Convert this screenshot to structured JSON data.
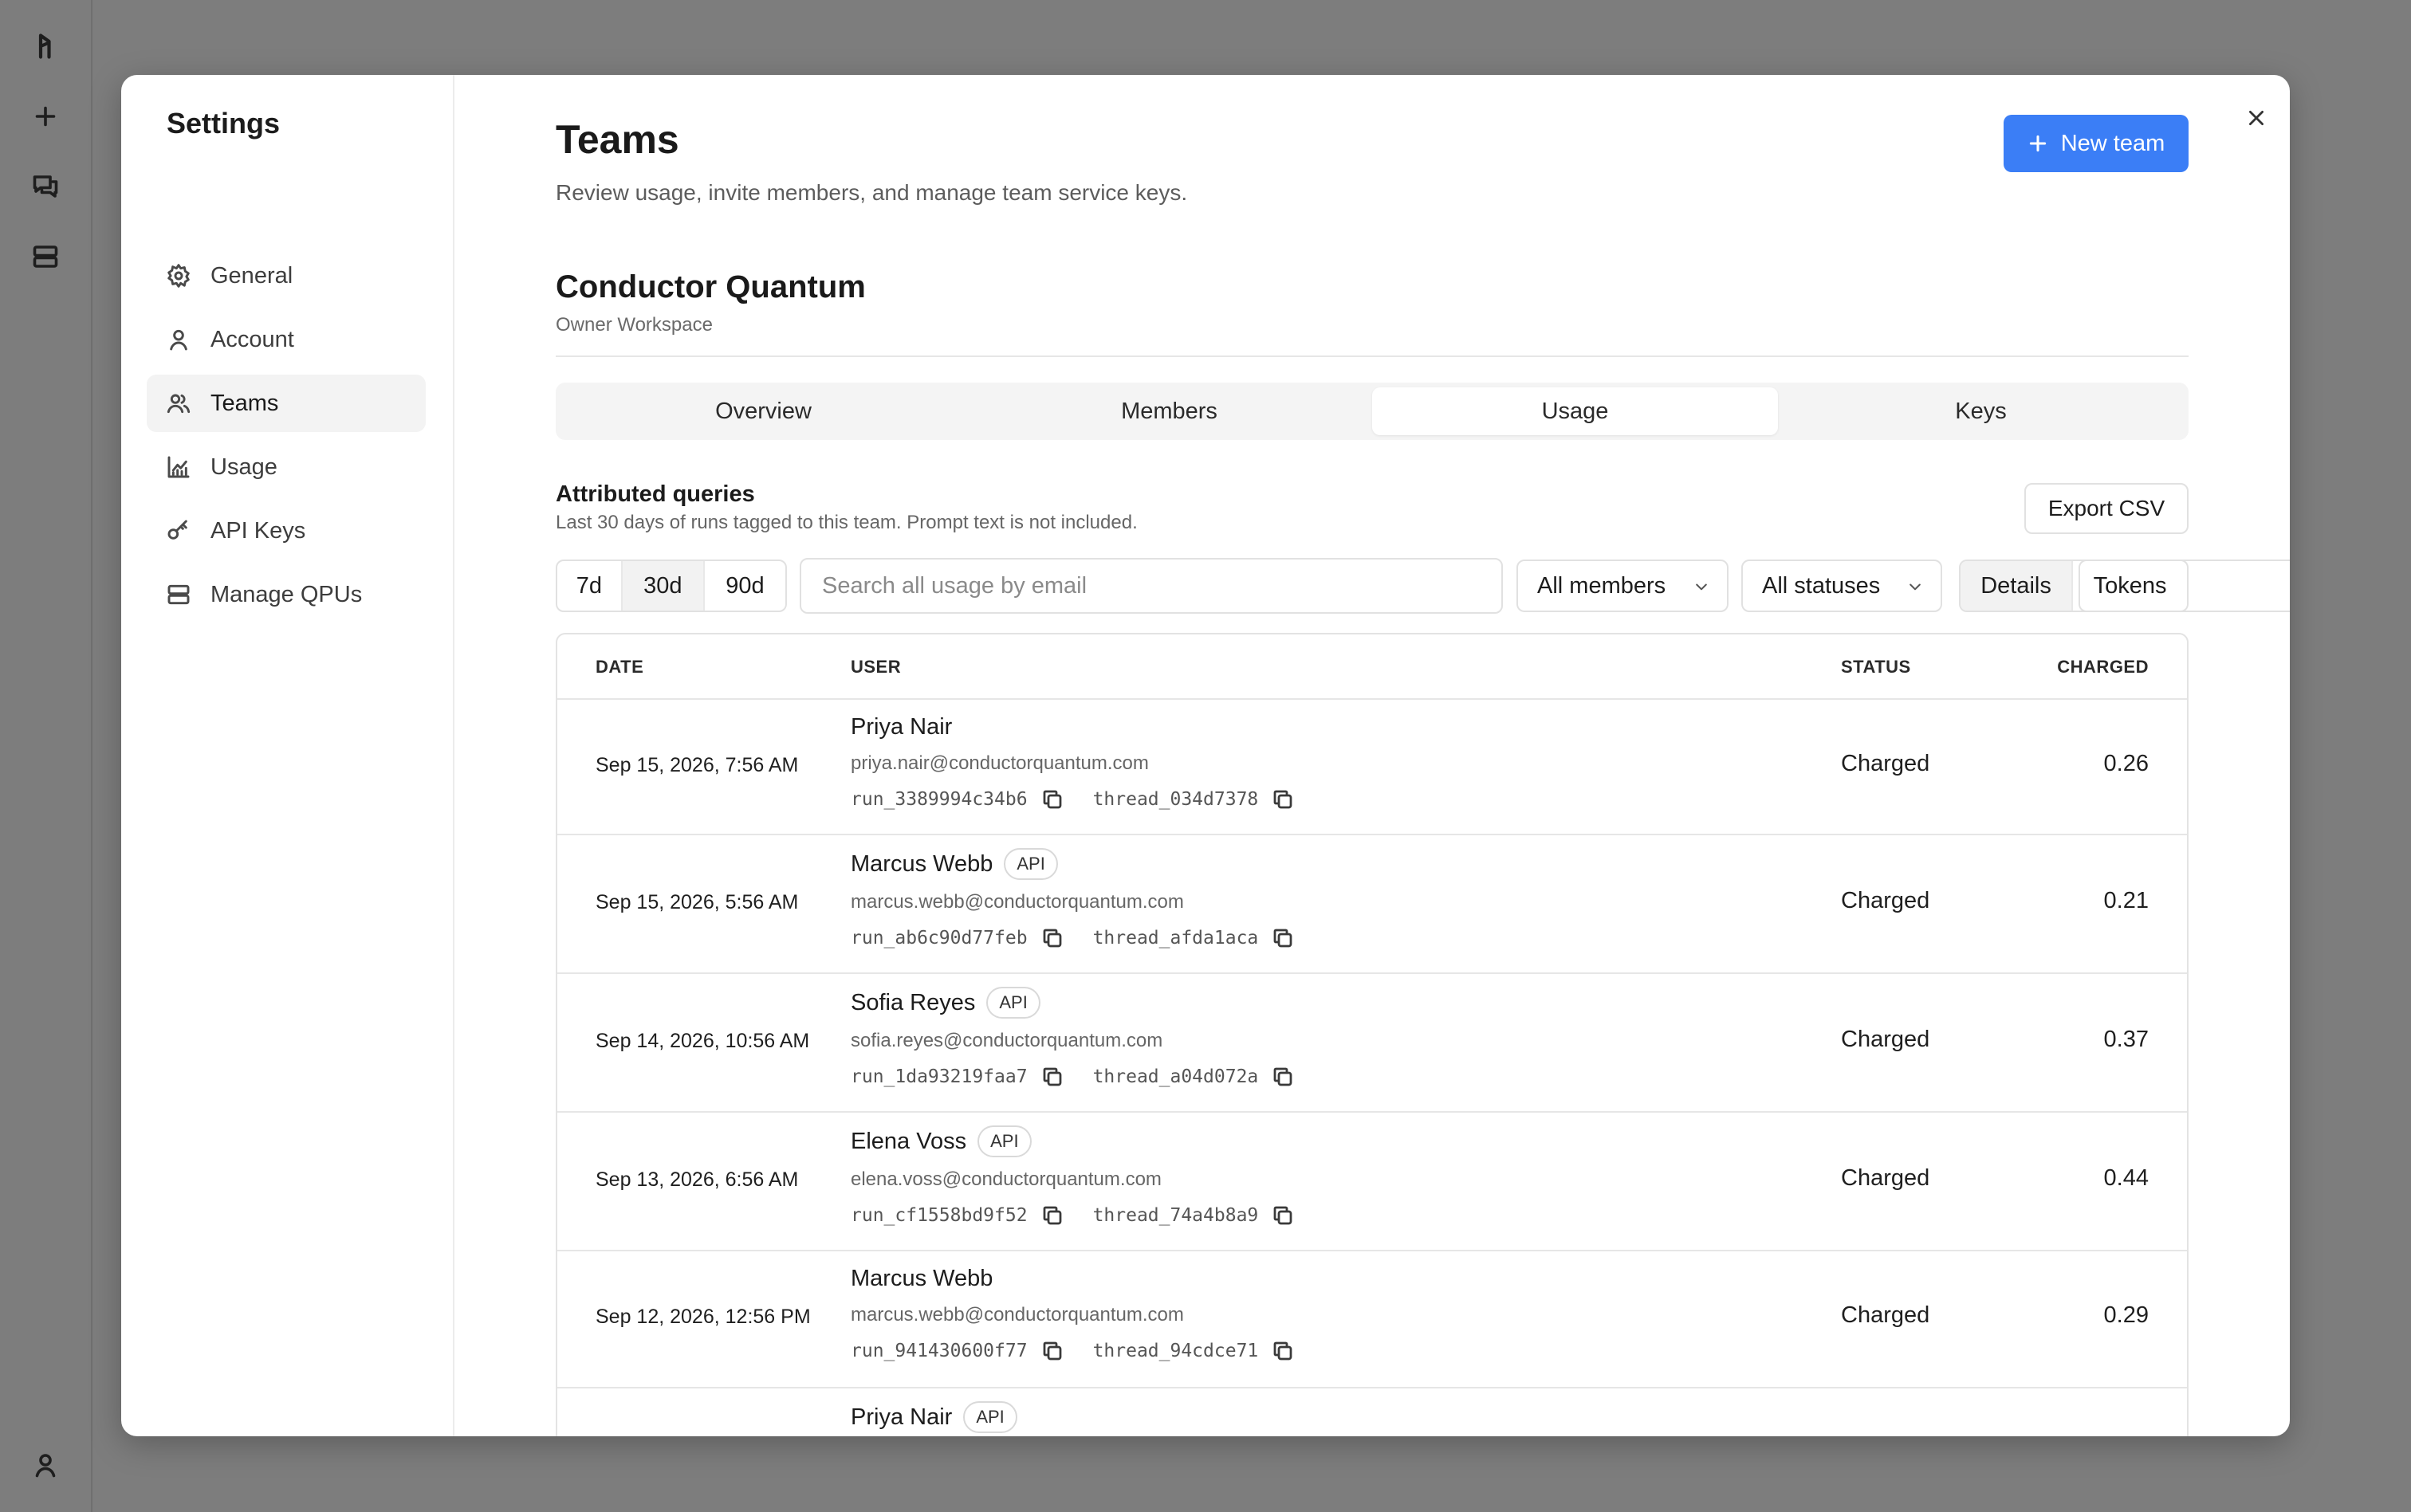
{
  "rail": {
    "icons": [
      "logo-icon",
      "plus-icon",
      "chat-icon",
      "server-icon",
      "user-icon"
    ]
  },
  "settings": {
    "title": "Settings",
    "nav": [
      {
        "label": "General",
        "icon": "gear-icon"
      },
      {
        "label": "Account",
        "icon": "user-icon"
      },
      {
        "label": "Teams",
        "icon": "users-icon",
        "active": true
      },
      {
        "label": "Usage",
        "icon": "chart-icon"
      },
      {
        "label": "API Keys",
        "icon": "key-icon"
      },
      {
        "label": "Manage QPUs",
        "icon": "server-icon"
      }
    ]
  },
  "header": {
    "title": "Teams",
    "subtitle": "Review usage, invite members, and manage team service keys.",
    "new_team_label": "New team"
  },
  "team": {
    "name": "Conductor Quantum",
    "role": "Owner Workspace"
  },
  "tabs": [
    {
      "label": "Overview"
    },
    {
      "label": "Members"
    },
    {
      "label": "Usage",
      "active": true
    },
    {
      "label": "Keys"
    }
  ],
  "usage": {
    "title": "Attributed queries",
    "subtitle": "Last 30 days of runs tagged to this team. Prompt text is not included.",
    "export_label": "Export CSV",
    "ranges": [
      "7d",
      "30d",
      "90d"
    ],
    "active_range": "30d",
    "search_placeholder": "Search all usage by email",
    "member_filter": "All members",
    "status_filter": "All statuses",
    "views": [
      "Details",
      "Tokens"
    ],
    "active_view": "Details"
  },
  "table": {
    "columns": [
      "DATE",
      "USER",
      "STATUS",
      "CHARGED"
    ],
    "rows": [
      {
        "date": "Sep 15, 2026, 7:56 AM",
        "name": "Priya Nair",
        "api": false,
        "email": "priya.nair@conductorquantum.com",
        "run": "run_3389994c34b6",
        "thread": "thread_034d7378",
        "status": "Charged",
        "charged": "0.26"
      },
      {
        "date": "Sep 15, 2026, 5:56 AM",
        "name": "Marcus Webb",
        "api": true,
        "email": "marcus.webb@conductorquantum.com",
        "run": "run_ab6c90d77feb",
        "thread": "thread_afda1aca",
        "status": "Charged",
        "charged": "0.21"
      },
      {
        "date": "Sep 14, 2026, 10:56 AM",
        "name": "Sofia Reyes",
        "api": true,
        "email": "sofia.reyes@conductorquantum.com",
        "run": "run_1da93219faa7",
        "thread": "thread_a04d072a",
        "status": "Charged",
        "charged": "0.37"
      },
      {
        "date": "Sep 13, 2026, 6:56 AM",
        "name": "Elena Voss",
        "api": true,
        "email": "elena.voss@conductorquantum.com",
        "run": "run_cf1558bd9f52",
        "thread": "thread_74a4b8a9",
        "status": "Charged",
        "charged": "0.44"
      },
      {
        "date": "Sep 12, 2026, 12:56 PM",
        "name": "Marcus Webb",
        "api": false,
        "email": "marcus.webb@conductorquantum.com",
        "run": "run_941430600f77",
        "thread": "thread_94cdce71",
        "status": "Charged",
        "charged": "0.29"
      },
      {
        "date": "",
        "name": "Priya Nair",
        "api": true,
        "email": "",
        "run": "",
        "thread": "",
        "status": "",
        "charged": ""
      }
    ],
    "api_badge": "API"
  }
}
